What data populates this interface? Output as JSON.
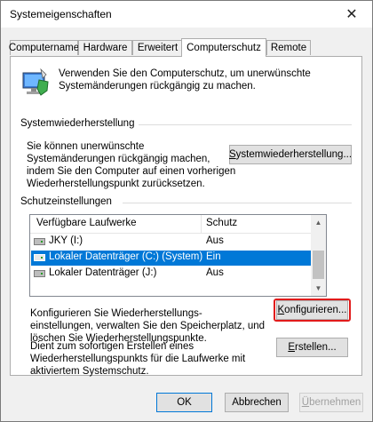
{
  "window": {
    "title": "Systemeigenschaften"
  },
  "tabs": [
    {
      "label": "Computername",
      "active": false
    },
    {
      "label": "Hardware",
      "active": false
    },
    {
      "label": "Erweitert",
      "active": false
    },
    {
      "label": "Computerschutz",
      "active": true
    },
    {
      "label": "Remote",
      "active": false
    }
  ],
  "intro": {
    "icon": "computer-shield-icon",
    "line1": "Verwenden Sie den Computerschutz, um unerwünschte",
    "line2": "Systemänderungen rückgängig zu machen."
  },
  "restore_section": {
    "header": "Systemwiederherstellung",
    "desc_line1": "Sie können unerwünschte",
    "desc_line2": "Systemänderungen rückgängig machen,",
    "desc_line3": "indem Sie den Computer auf einen vorherigen",
    "desc_line4": "Wiederherstellungspunkt zurücksetzen.",
    "button_accel": "S",
    "button_rest": "ystemwiederherstellung..."
  },
  "protection_section": {
    "header": "Schutzeinstellungen",
    "columns": [
      "Verfügbare Laufwerke",
      "Schutz"
    ],
    "drives": [
      {
        "name": "JKY (I:)",
        "protection": "Aus",
        "selected": false
      },
      {
        "name": "Lokaler Datenträger (C:) (System)",
        "protection": "Ein",
        "selected": true
      },
      {
        "name": "Lokaler Datenträger (J:)",
        "protection": "Aus",
        "selected": false
      }
    ],
    "configure_line1": "Konfigurieren Sie Wiederherstellungs-",
    "configure_line2": "einstellungen, verwalten Sie den Speicherplatz, und",
    "configure_line3": "löschen Sie Wiederherstellungspunkte.",
    "configure_accel": "K",
    "configure_rest": "onfigurieren...",
    "create_line1": "Dient zum sofortigen Erstellen eines",
    "create_line2": "Wiederherstellungspunkts für die Laufwerke mit",
    "create_line3": "aktiviertem Systemschutz.",
    "create_accel": "E",
    "create_rest": "rstellen..."
  },
  "footer": {
    "ok": "OK",
    "cancel": "Abbrechen",
    "apply_accel": "Ü",
    "apply_rest": "bernehmen"
  },
  "colors": {
    "accent": "#0078d7",
    "highlight": "#e11b1b"
  }
}
